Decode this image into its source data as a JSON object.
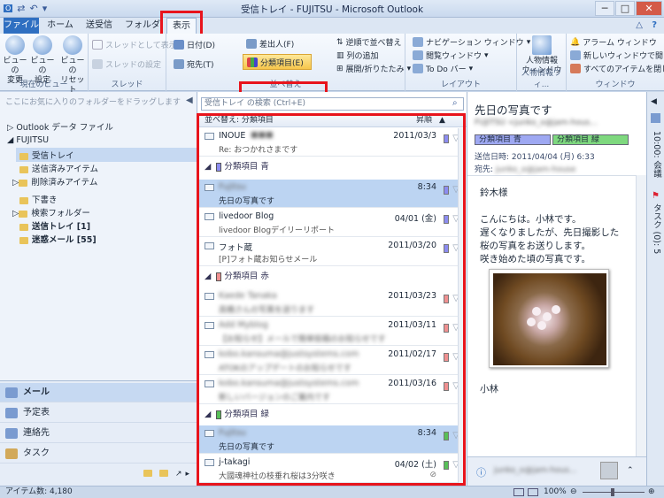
{
  "window": {
    "title": "受信トレイ - FUJITSU - Microsoft Outlook",
    "minimize": "─",
    "maximize": "□",
    "close": "✕",
    "help": "?"
  },
  "tabs": [
    {
      "label": "ファイル"
    },
    {
      "label": "ホーム"
    },
    {
      "label": "送受信"
    },
    {
      "label": "フォルダー"
    },
    {
      "label": "表示"
    }
  ],
  "ribbon": {
    "view_change": "ビューの\n変更",
    "view_settings": "ビューの\n設定",
    "view_reset": "ビューの\nリセット",
    "group_current_view": "現在のビュー",
    "thread_show": "スレッドとして表示",
    "thread_settings": "スレッドの設定",
    "group_thread": "スレッド",
    "arr_date": "日付(D)",
    "arr_from": "差出人(F)",
    "arr_to": "宛先(T)",
    "arr_category": "分類項目(E)",
    "reverse": "逆順で並べ替え",
    "add_col": "列の追加",
    "expand": "展開/折りたたみ",
    "group_arrange": "並べ替え",
    "nav_pane": "ナビゲーション ウィンドウ",
    "read_pane": "閲覧ウィンドウ",
    "todo_bar": "To Do バー",
    "group_layout": "レイアウト",
    "people_pane": "人物情報\nウィンドウ",
    "group_people": "人物情報ウィ...",
    "reminder": "アラーム ウィンドウ",
    "new_window": "新しいウィンドウで開く",
    "close_all": "すべてのアイテムを閉じる",
    "group_window": "ウィンドウ"
  },
  "nav": {
    "hint": "ここにお気に入りのフォルダーをドラッグします",
    "data_file": "Outlook データ ファイル",
    "account": "FUJITSU",
    "folders": [
      {
        "label": "受信トレイ"
      },
      {
        "label": "送信済みアイテム"
      },
      {
        "label": "削除済みアイテム"
      },
      {
        "label": "下書き"
      },
      {
        "label": "検索フォルダー"
      },
      {
        "label": "送信トレイ [1]"
      },
      {
        "label": "迷惑メール [55]"
      }
    ],
    "modules": [
      {
        "label": "メール"
      },
      {
        "label": "予定表"
      },
      {
        "label": "連絡先"
      },
      {
        "label": "タスク"
      }
    ]
  },
  "list": {
    "search_placeholder": "受信トレイ の検索 (Ctrl+E)",
    "sort_label": "並べ替え: 分類項目",
    "sort_order": "昇順",
    "groups": [
      "分類項目 青",
      "分類項目 赤",
      "分類項目 緑"
    ],
    "rows": [
      {
        "from": "INOUE",
        "subject": "Re: おつかれさまです",
        "date": "2011/03/3"
      },
      {
        "from": "Fujitsu",
        "subject": "先日の写真です",
        "date": "8:34"
      },
      {
        "from": "livedoor Blog",
        "subject": "livedoor Blogデイリーリポート",
        "date": "04/01 (金)"
      },
      {
        "from": "フォト蔵",
        "subject": "[P]フォト蔵お知らせメール",
        "date": "2011/03/20"
      },
      {
        "from": "Kaede Tanaka",
        "subject": "高橋さんの写真を送ります",
        "date": "2011/03/23"
      },
      {
        "from": "Add Myblog",
        "subject": "【お知らせ】メールで簡単投稿のお知らせです",
        "date": "2011/03/11"
      },
      {
        "from": "kobo.kansuma@justsystems.com",
        "subject": "ATOKのアップデートのお知らせです",
        "date": "2011/02/17"
      },
      {
        "from": "kobo.kansuma@justsystems.com",
        "subject": "新しいバージョンのご案内です",
        "date": "2011/03/16"
      },
      {
        "from": "Fujitsu",
        "subject": "先日の写真です",
        "date": "8:34"
      },
      {
        "from": "j-takagi",
        "subject": "大國魂神社の枝垂れ桜は3分咲き",
        "date": "04/02 (土)"
      }
    ]
  },
  "reading": {
    "title": "先日の写真です",
    "from": "FUJITSU <junko_o@jam-hous...",
    "cat_blue": "分類項目 青",
    "cat_green": "分類項目 緑",
    "sent_label": "送信日時:",
    "sent_value": "2011/04/04 (月) 6:33",
    "to_label": "宛先:",
    "to_value": "junko_o@jam-house",
    "body": [
      "鈴木様",
      "こんにちは。小林です。",
      "遅くなりましたが、先日撮影した",
      "桜の写真をお送りします。",
      "咲き始めた頃の写真です。",
      "小林"
    ],
    "footer_email": "junko_o@jam-hous..."
  },
  "todo_bar": {
    "calendar": "10:00: 会議",
    "tasks": "タスク (0): 5"
  },
  "status": {
    "items": "アイテム数: 4,180",
    "zoom": "100%"
  }
}
